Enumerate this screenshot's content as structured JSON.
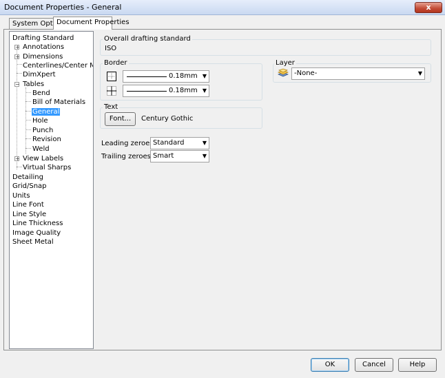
{
  "window": {
    "title": "Document Properties - General",
    "close_glyph": "x"
  },
  "tabs": [
    {
      "label": "System Options"
    },
    {
      "label": "Document Properties"
    }
  ],
  "tree": {
    "drafting_standard": "Drafting Standard",
    "annotations": "Annotations",
    "dimensions": "Dimensions",
    "centerlines": "Centerlines/Center Marks",
    "dimxpert": "DimXpert",
    "tables": "Tables",
    "bend": "Bend",
    "bill_of_materials": "Bill of Materials",
    "general": "General",
    "hole": "Hole",
    "punch": "Punch",
    "revision": "Revision",
    "weld": "Weld",
    "view_labels": "View Labels",
    "virtual_sharps": "Virtual Sharps",
    "detailing": "Detailing",
    "grid_snap": "Grid/Snap",
    "units": "Units",
    "line_font": "Line Font",
    "line_style": "Line Style",
    "line_thickness": "Line Thickness",
    "image_quality": "Image Quality",
    "sheet_metal": "Sheet Metal"
  },
  "overall": {
    "label": "Overall drafting standard",
    "value": "ISO"
  },
  "border": {
    "label": "Border",
    "outer_thickness": "0.18mm",
    "inner_thickness": "0.18mm"
  },
  "text": {
    "label": "Text",
    "font_button": "Font...",
    "font_name": "Century Gothic"
  },
  "leading_zeroes": {
    "label": "Leading zeroes:",
    "value": "Standard"
  },
  "trailing_zeroes": {
    "label": "Trailing zeroes:",
    "value": "Smart"
  },
  "layer": {
    "label": "Layer",
    "value": "-None-"
  },
  "buttons": {
    "ok": "OK",
    "cancel": "Cancel",
    "help": "Help"
  },
  "dropdown_arrow": "▼",
  "colors": {
    "selection": "#3399ff",
    "title_gradient_top": "#e6eefb",
    "close_red": "#c24a35"
  }
}
